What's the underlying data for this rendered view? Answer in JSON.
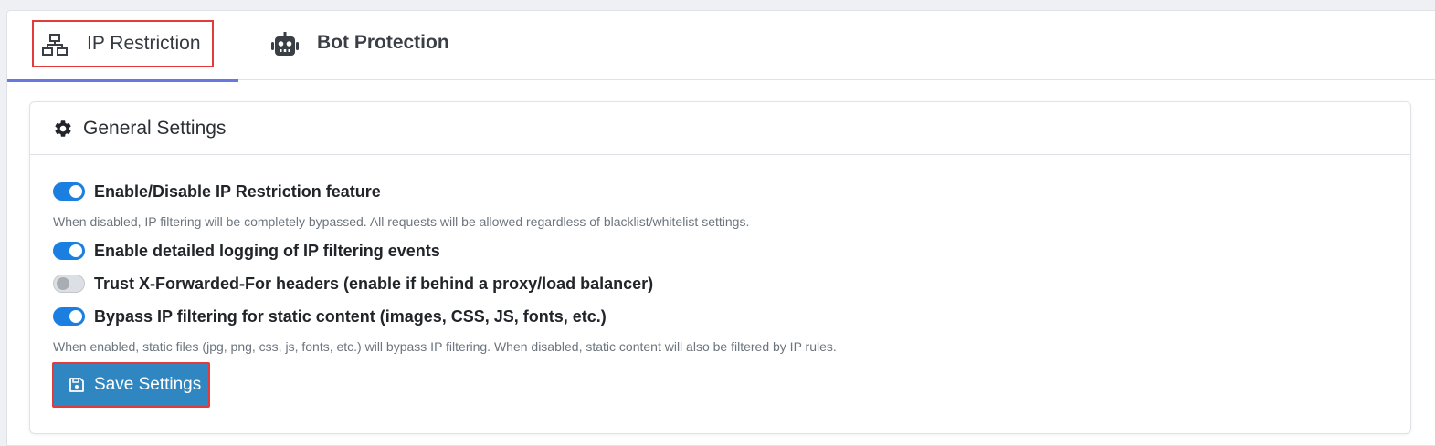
{
  "tabs": [
    {
      "label": "IP Restriction",
      "icon": "network-icon",
      "active": true
    },
    {
      "label": "Bot Protection",
      "icon": "robot-icon",
      "active": false
    }
  ],
  "card": {
    "title": "General Settings",
    "icon": "gear-icon",
    "settings": [
      {
        "label": "Enable/Disable IP Restriction feature",
        "enabled": true,
        "help": "When disabled, IP filtering will be completely bypassed. All requests will be allowed regardless of blacklist/whitelist settings."
      },
      {
        "label": "Enable detailed logging of IP filtering events",
        "enabled": true
      },
      {
        "label": "Trust X-Forwarded-For headers (enable if behind a proxy/load balancer)",
        "enabled": false
      },
      {
        "label": "Bypass IP filtering for static content (images, CSS, JS, fonts, etc.)",
        "enabled": true,
        "help": "When enabled, static files (jpg, png, css, js, fonts, etc.) will bypass IP filtering. When disabled, static content will also be filtered by IP rules."
      }
    ],
    "save_label": "Save Settings",
    "save_icon": "floppy-disk-icon"
  },
  "colors": {
    "accent": "#1a7fe0",
    "tab_underline": "#6779e0",
    "button": "#2f86c0",
    "highlight": "#e33a3a"
  }
}
